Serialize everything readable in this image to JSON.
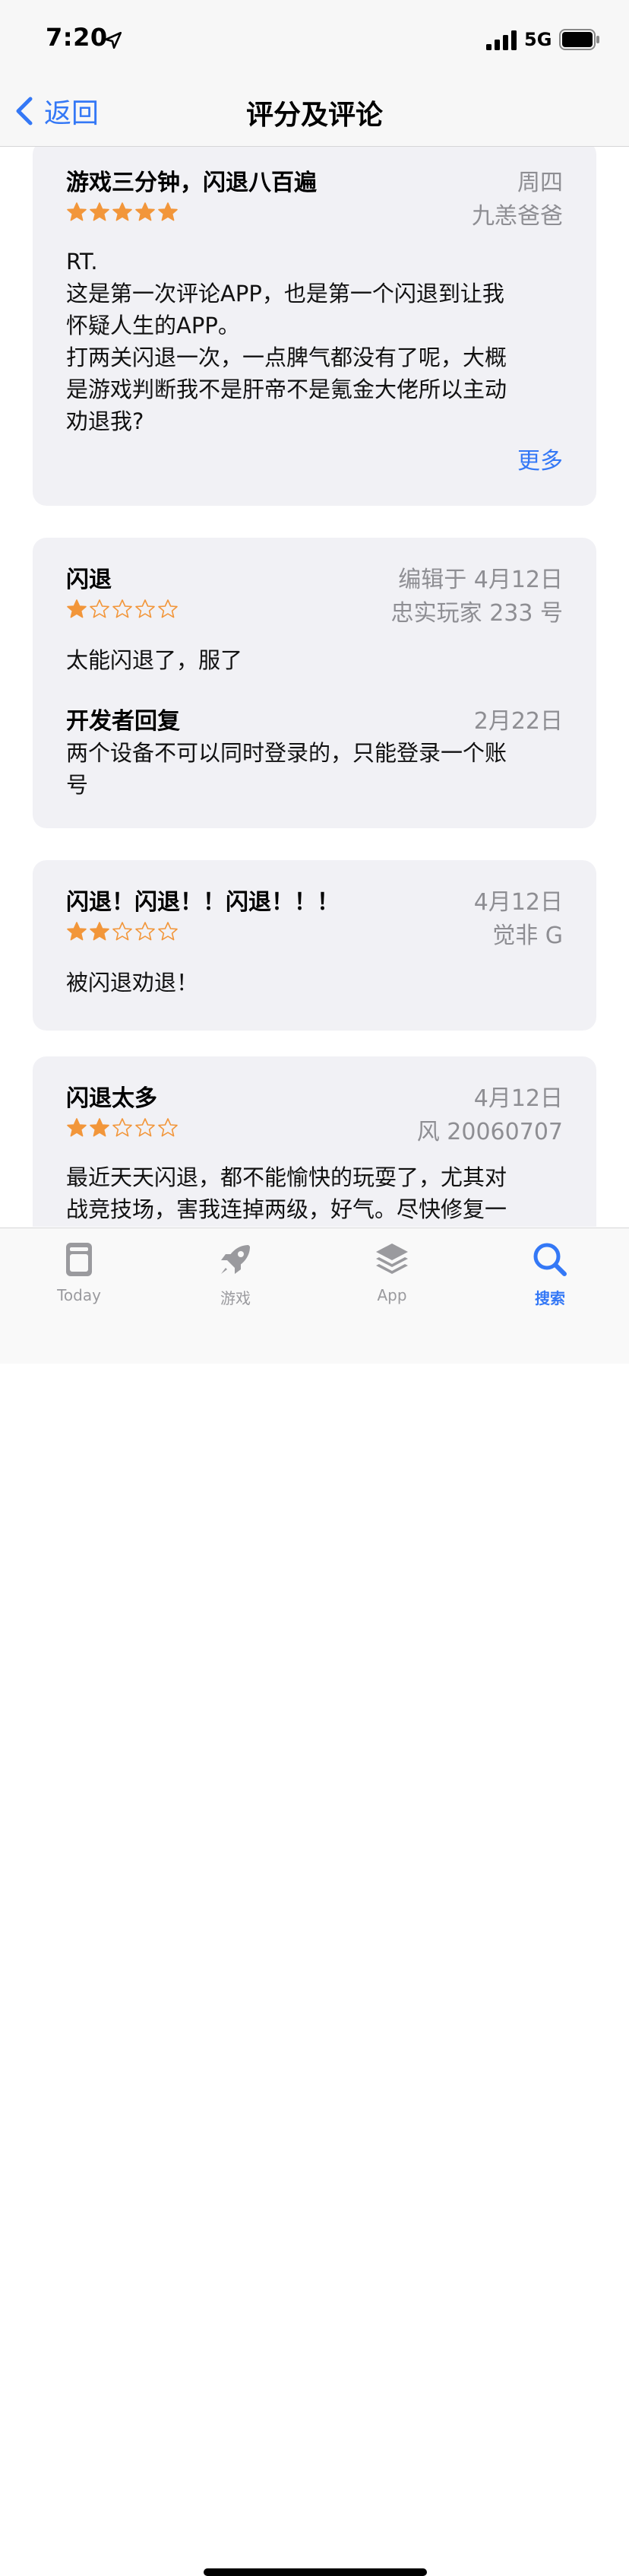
{
  "status": {
    "time": "7:20",
    "network": "5G"
  },
  "nav": {
    "back_label": "返回",
    "title": "评分及评论"
  },
  "reviews": [
    {
      "title": "游戏三分钟，闪退八百遍",
      "date": "周四",
      "author": "九恙爸爸",
      "rating": 5,
      "body": [
        "RT.",
        "这是第一次评论APP，也是第一个闪退到让我",
        "怀疑人生的APP。",
        "打两关闪退一次，一点脾气都没有了呢，大概",
        "是游戏判断我不是肝帝不是氪金大佬所以主动",
        "劝退我?"
      ],
      "more_label": "更多"
    },
    {
      "title": "闪退",
      "date": "编辑于 4月12日",
      "author": "忠实玩家 233 号",
      "rating": 1,
      "body": [
        "太能闪退了，服了"
      ],
      "developer_reply": {
        "title": "开发者回复",
        "date": "2月22日",
        "body": [
          "两个设备不可以同时登录的，只能登录一个账",
          "号"
        ]
      }
    },
    {
      "title": "闪退！闪退！！闪退！！！",
      "date": "4月12日",
      "author": "觉非 G",
      "rating": 2,
      "body": [
        "被闪退劝退！"
      ]
    },
    {
      "title": "闪退太多",
      "date": "4月12日",
      "author": "风 20060707",
      "rating": 2,
      "body": [
        "最近天天闪退，都不能愉快的玩耍了，尤其对",
        "战竞技场，害我连掉两级，好气。尽快修复一"
      ]
    }
  ],
  "tabs": [
    {
      "label": "Today",
      "icon": "today-icon",
      "active": false
    },
    {
      "label": "游戏",
      "icon": "rocket-icon",
      "active": false
    },
    {
      "label": "App",
      "icon": "layers-icon",
      "active": false
    },
    {
      "label": "搜索",
      "icon": "search-icon",
      "active": true
    }
  ],
  "colors": {
    "accent": "#3478f6",
    "star": "#f2963a",
    "card_bg": "#f1f1f5",
    "secondary_text": "#8e8e93"
  }
}
